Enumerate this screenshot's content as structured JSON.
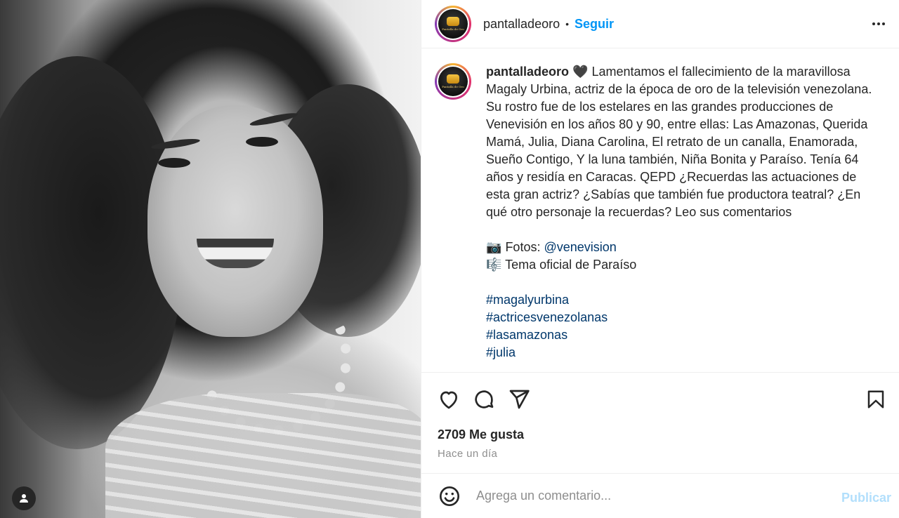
{
  "post": {
    "image_alt": "",
    "tag_icon": "user-icon"
  },
  "header": {
    "username": "pantalladeoro",
    "separator": "•",
    "follow_label": "Seguir",
    "more_icon": "more-horizontal-icon",
    "avatar_logo_text": "Pantalla de Oro"
  },
  "caption": {
    "username": "pantalladeoro",
    "heart": "🖤",
    "text": "Lamentamos el fallecimiento de la maravillosa Magaly Urbina, actriz de la época de oro de la televisión venezolana. Su rostro fue de los estelares en las grandes producciones de Venevisión en los años 80 y 90, entre ellas: Las Amazonas, Querida Mamá, Julia, Diana Carolina, El retrato de un canalla, Enamorada, Sueño Contigo, Y la luna también, Niña Bonita y Paraíso. Tenía 64 años y residía en Caracas. QEPD ¿Recuerdas las actuaciones de esta gran actriz? ¿Sabías que también fue productora teatral? ¿En qué otro personaje la recuerdas? Leo sus comentarios",
    "photos_emoji": "📷",
    "photos_label": "Fotos: ",
    "photos_mention": "@venevision",
    "music_emoji": "🎼",
    "music_label": "Tema oficial de Paraíso",
    "hashtags": [
      "#magalyurbina",
      "#actricesvenezolanas",
      "#lasamazonas",
      "#julia"
    ]
  },
  "actions": {
    "like_icon": "heart-icon",
    "comment_icon": "comment-icon",
    "share_icon": "send-icon",
    "save_icon": "bookmark-icon",
    "likes_text": "2709 Me gusta",
    "timestamp": "Hace un día"
  },
  "comment_box": {
    "emoji_icon": "smiley-icon",
    "placeholder": "Agrega un comentario...",
    "publish_label": "Publicar"
  },
  "colors": {
    "link_blue": "#0095f6",
    "hashtag_blue": "#00376b",
    "publish_disabled": "#b2dffc",
    "muted": "#8e8e8e"
  }
}
